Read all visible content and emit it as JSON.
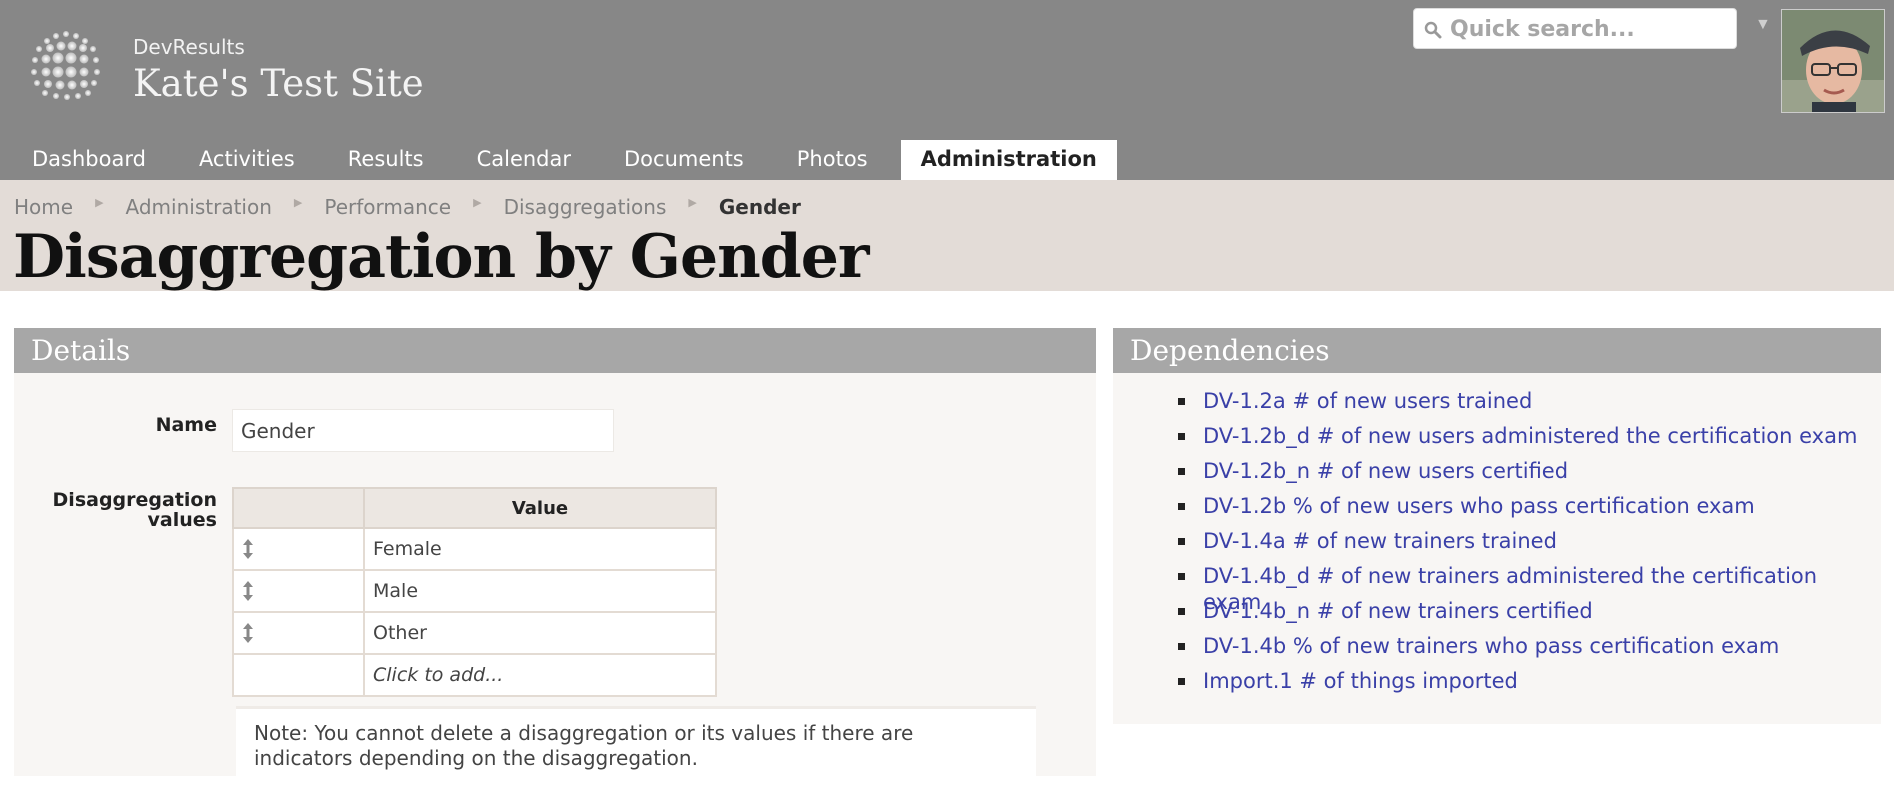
{
  "site": {
    "org": "DevResults",
    "title": "Kate's Test Site"
  },
  "search": {
    "placeholder": "Quick search..."
  },
  "nav": {
    "items": [
      "Dashboard",
      "Activities",
      "Results",
      "Calendar",
      "Documents",
      "Photos",
      "Administration"
    ],
    "active": "Administration"
  },
  "breadcrumb": {
    "items": [
      "Home",
      "Administration",
      "Performance",
      "Disaggregations"
    ],
    "current": "Gender"
  },
  "page": {
    "title": "Disaggregation by Gender"
  },
  "details": {
    "heading": "Details",
    "name_label": "Name",
    "name_value": "Gender",
    "values_label_line1": "Disaggregation",
    "values_label_line2": "values",
    "table_header_value": "Value",
    "values": [
      "Female",
      "Male",
      "Other"
    ],
    "add_placeholder": "Click to add...",
    "note": "Note: You cannot delete a disaggregation or its values if there are indicators depending on the disaggregation."
  },
  "dependencies": {
    "heading": "Dependencies",
    "items": [
      "DV-1.2a # of new users trained",
      "DV-1.2b_d # of new users administered the certification exam",
      "DV-1.2b_n # of new users certified",
      "DV-1.2b % of new users who pass certification exam",
      "DV-1.4a # of new trainers trained",
      "DV-1.4b_d # of new trainers administered the certification exam",
      "DV-1.4b_n # of new trainers certified",
      "DV-1.4b % of new trainers who pass certification exam",
      "Import.1 # of things imported"
    ]
  },
  "colors": {
    "header_bg": "#878787",
    "crumb_band": "#e3dcd7",
    "panel_head": "#a7a7a7",
    "link": "#3a40a8"
  }
}
